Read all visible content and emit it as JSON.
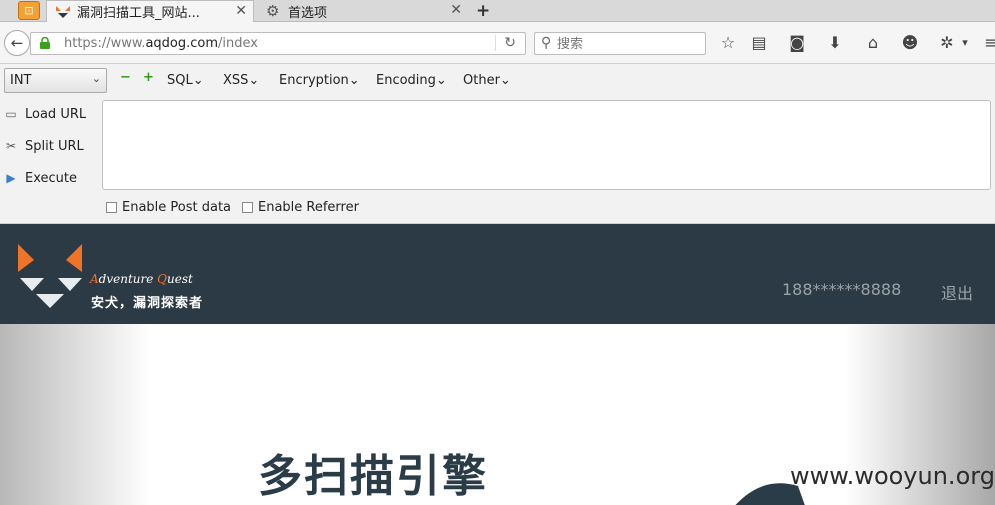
{
  "browser": {
    "tabs": [
      {
        "label": "漏洞扫描工具_网站...",
        "active": true
      },
      {
        "label": "首选项",
        "active": false
      }
    ],
    "url": {
      "scheme": "https://www.",
      "host": "aqdog.com",
      "path": "/index"
    },
    "search_placeholder": "搜索"
  },
  "hackbar": {
    "select_value": "INT",
    "menus": [
      "SQL",
      "XSS",
      "Encryption",
      "Encoding",
      "Other"
    ],
    "buttons": {
      "load": "Load URL",
      "split": "Split URL",
      "execute": "Execute"
    },
    "checkboxes": {
      "post": "Enable Post data",
      "referrer": "Enable Referrer"
    }
  },
  "site": {
    "logo_line1_a": "A",
    "logo_line1_b": "dventure ",
    "logo_line1_c": "Q",
    "logo_line1_d": "uest",
    "logo_line2": "安犬，漏洞探索者",
    "user_phone": "188******8888",
    "logout": "退出",
    "hero_title": "多扫描引擎",
    "watermark": "www.wooyun.org"
  },
  "colors": {
    "header_bg": "#2b3a44",
    "accent": "#f07428"
  }
}
